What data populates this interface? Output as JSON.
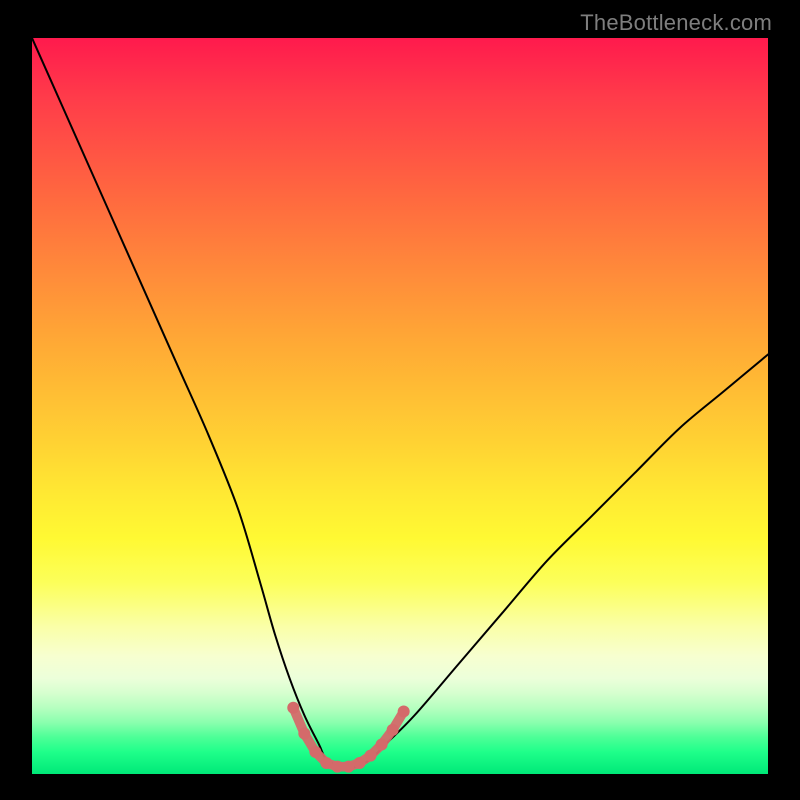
{
  "watermark": {
    "text": "TheBottleneck.com"
  },
  "chart_data": {
    "type": "line",
    "title": "",
    "xlabel": "",
    "ylabel": "",
    "xlim": [
      0,
      100
    ],
    "ylim": [
      0,
      100
    ],
    "grid": false,
    "legend": false,
    "background_gradient": {
      "top": "#ff1a4d",
      "bottom": "#00e878",
      "meaning": "red = high bottleneck, green = no bottleneck"
    },
    "series": [
      {
        "name": "bottleneck-curve",
        "color": "#000000",
        "stroke_width": 2,
        "x": [
          0,
          4,
          8,
          12,
          16,
          20,
          24,
          28,
          31,
          33,
          35,
          37,
          39,
          40,
          42,
          44,
          46,
          48,
          52,
          58,
          64,
          70,
          76,
          82,
          88,
          94,
          100
        ],
        "values": [
          100,
          91,
          82,
          73,
          64,
          55,
          46,
          36,
          26,
          19,
          13,
          8,
          4,
          2,
          1,
          1,
          2,
          4,
          8,
          15,
          22,
          29,
          35,
          41,
          47,
          52,
          57
        ]
      },
      {
        "name": "tolerance-band-markers",
        "type": "scatter",
        "color": "#d46a6a",
        "marker_radius": 6,
        "x": [
          35.5,
          37.0,
          38.5,
          40.0,
          41.5,
          43.0,
          44.5,
          46.0,
          47.5,
          49.0,
          50.5
        ],
        "values": [
          9.0,
          5.5,
          3.0,
          1.5,
          1.0,
          1.0,
          1.5,
          2.5,
          4.0,
          6.0,
          8.5
        ]
      }
    ],
    "optimum_x": 42,
    "optimum_value": 1
  }
}
